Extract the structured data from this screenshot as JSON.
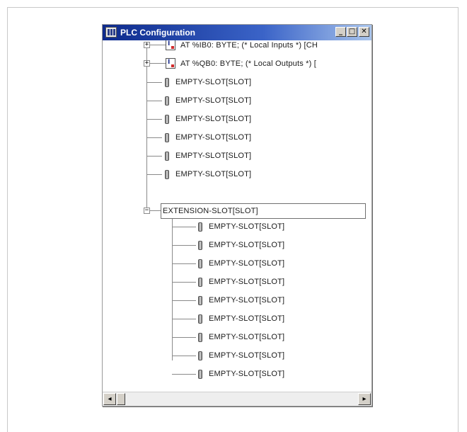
{
  "window": {
    "title": "PLC Configuration",
    "minimize_symbol": "_",
    "maximize_symbol": "□",
    "close_symbol": "✕"
  },
  "tree": {
    "expander_collapsed_symbol": "+",
    "expander_expanded_symbol": "−",
    "io_icon_symbol": "I",
    "io_nodes": [
      {
        "label": "AT %IB0: BYTE; (* Local Inputs *) [CH",
        "icon": "input-module-icon"
      },
      {
        "label": "AT %QB0: BYTE; (* Local Outputs *) [",
        "icon": "output-module-icon"
      }
    ],
    "top_slots": [
      "EMPTY-SLOT[SLOT]",
      "EMPTY-SLOT[SLOT]",
      "EMPTY-SLOT[SLOT]",
      "EMPTY-SLOT[SLOT]",
      "EMPTY-SLOT[SLOT]",
      "EMPTY-SLOT[SLOT]"
    ],
    "extension": {
      "label": "EXTENSION-SLOT[SLOT]",
      "children": [
        "EMPTY-SLOT[SLOT]",
        "EMPTY-SLOT[SLOT]",
        "EMPTY-SLOT[SLOT]",
        "EMPTY-SLOT[SLOT]",
        "EMPTY-SLOT[SLOT]",
        "EMPTY-SLOT[SLOT]",
        "EMPTY-SLOT[SLOT]",
        "EMPTY-SLOT[SLOT]",
        "EMPTY-SLOT[SLOT]"
      ]
    }
  },
  "scrollbar": {
    "left_arrow": "◂",
    "right_arrow": "▸"
  },
  "colors": {
    "titlebar_start": "#0d2a8c",
    "titlebar_end": "#a8c4ec",
    "tree_line": "#8a8a8a"
  }
}
